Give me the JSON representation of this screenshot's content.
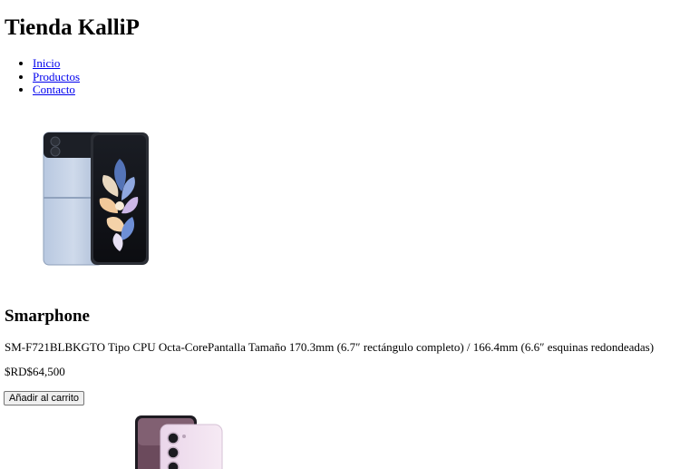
{
  "site": {
    "title": "Tienda KalliP"
  },
  "nav": {
    "items": [
      {
        "label": "Inicio"
      },
      {
        "label": "Productos"
      },
      {
        "label": "Contacto"
      }
    ]
  },
  "products": [
    {
      "image": "samsung-galaxy-z-flip4-blue-image",
      "name": "Smarphone",
      "description": "SM-F721BLBKGTO Tipo CPU Octa-CorePantalla Tamaño 170.3mm (6.7″ rectángulo completo) / 166.4mm (6.6″ esquinas redondeadas)",
      "price": "$RD$64,500",
      "button_label": "Añadir al carrito"
    },
    {
      "image": "samsung-galaxy-s23-lavender-image"
    }
  ]
}
